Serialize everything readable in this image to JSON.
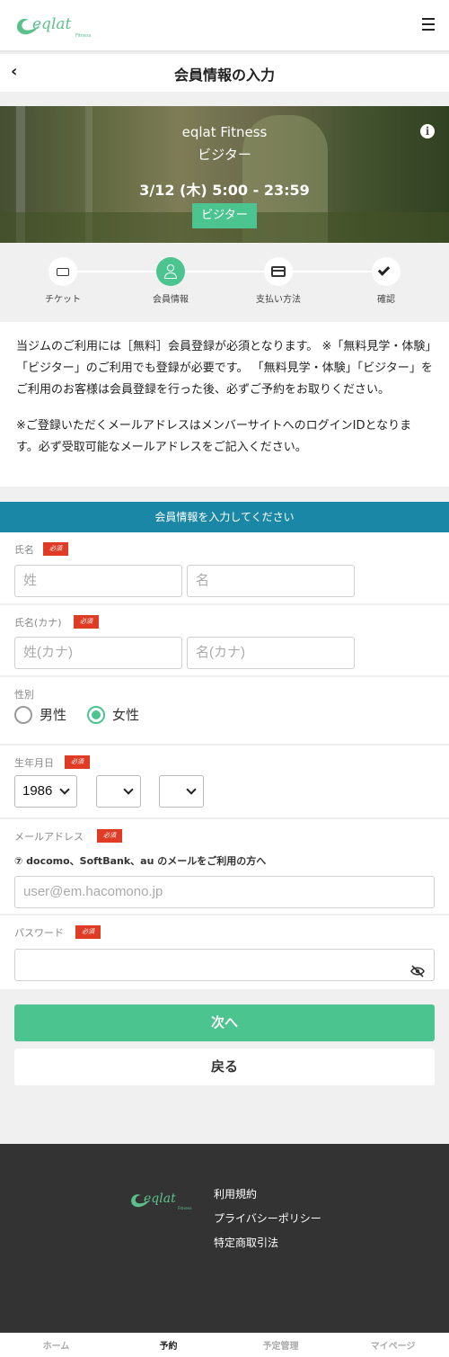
{
  "header": {
    "brand": "eqlat",
    "brand_sub": "Fitness",
    "menu_icon": "hamburger-menu-icon"
  },
  "titlebar": {
    "back_icon": "chevron-left-icon",
    "back_glyph": "‹",
    "title": "会員情報の入力"
  },
  "hero": {
    "gym_name": "eqlat Fitness",
    "plan": "ビジター",
    "date": "3/12 (木) 5:00 - 23:59",
    "badge": "ビジター",
    "info_icon": "info-icon",
    "info_glyph": "i"
  },
  "stepper": {
    "steps": [
      {
        "label": "チケット",
        "icon": "ticket-icon",
        "active": false
      },
      {
        "label": "会員情報",
        "icon": "user-icon",
        "active": true
      },
      {
        "label": "支払い方法",
        "icon": "credit-card-icon",
        "active": false
      },
      {
        "label": "確認",
        "icon": "check-icon",
        "active": false
      }
    ]
  },
  "notice": {
    "p1": "当ジムのご利用には［無料］会員登録が必須となります。 ※「無料見学・体験」「ビジター」のご利用でも登録が必要です。 「無料見学・体験」「ビジター」をご利用のお客様は会員登録を行った後、必ずご予約をお取りください。",
    "p2": "※ご登録いただくメールアドレスはメンバーサイトへのログインIDとなります。必ず受取可能なメールアドレスをご記入ください。"
  },
  "form": {
    "header": "会員情報を入力してください",
    "required_badge": "必須",
    "name": {
      "label": "氏名",
      "last_placeholder": "姓",
      "first_placeholder": "名"
    },
    "kana": {
      "label": "氏名(カナ)",
      "last_placeholder": "姓(カナ)",
      "first_placeholder": "名(カナ)"
    },
    "gender": {
      "label": "性別",
      "options": [
        "男性",
        "女性"
      ],
      "selected": "女性"
    },
    "birthday": {
      "label": "生年月日",
      "year": "1986",
      "month": "",
      "day": ""
    },
    "email": {
      "label": "メールアドレス",
      "hint": "⑦ docomo、SoftBank、au のメールをご利用の方へ",
      "placeholder": "user@em.hacomono.jp"
    },
    "password": {
      "label": "パスワード",
      "value": "",
      "toggle_icon": "eye-slash-icon"
    }
  },
  "actions": {
    "next": "次へ",
    "back": "戻る"
  },
  "footer": {
    "links": [
      "利用規約",
      "プライバシーポリシー",
      "特定商取引法"
    ]
  },
  "bottom_nav": {
    "items": [
      "ホーム",
      "予約",
      "予定管理",
      "マイページ"
    ],
    "active": "予約"
  },
  "colors": {
    "accent_green": "#4cc490",
    "form_header_blue": "#1b87a6",
    "required_red": "#e03b24",
    "footer_dark": "#333333"
  }
}
